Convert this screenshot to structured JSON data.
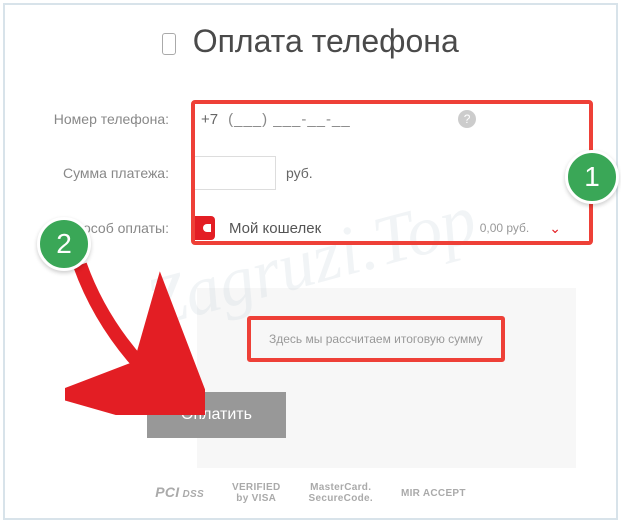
{
  "header": {
    "title": "Оплата телефона"
  },
  "form": {
    "phone": {
      "label": "Номер телефона:",
      "prefix": "+7",
      "mask": "(___) ___-__-__"
    },
    "amount": {
      "label": "Сумма платежа:",
      "currency": "руб."
    },
    "method": {
      "label": "особ оплаты:",
      "wallet_name": "Мой кошелек",
      "balance": "0,00 руб."
    }
  },
  "summary": {
    "hint": "Здесь мы рассчитаем итоговую сумму",
    "pay_button": "Оплатить"
  },
  "badges": {
    "one": "1",
    "two": "2"
  },
  "footer": {
    "pci": "PCI DSS",
    "visa_line1": "VERIFIED",
    "visa_line2": "by VISA",
    "mc_line1": "MasterCard.",
    "mc_line2": "SecureCode.",
    "mir": "MIR ACCEPT"
  },
  "watermark": "Zagruzi.Top"
}
